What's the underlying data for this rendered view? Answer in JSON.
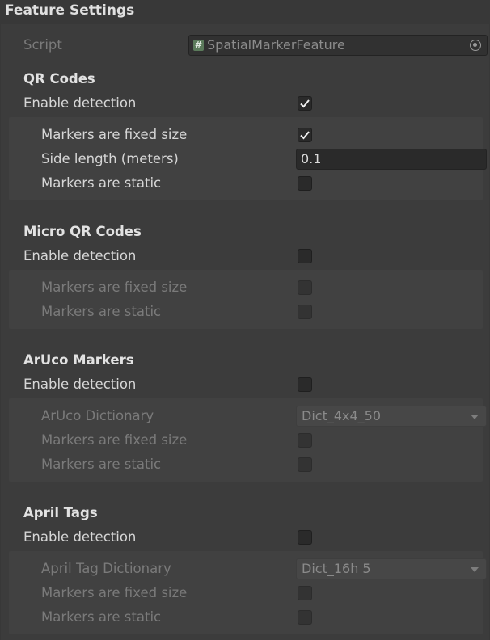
{
  "header": {
    "title": "Feature Settings"
  },
  "script": {
    "label": "Script",
    "value": "SpatialMarkerFeature",
    "icon": "script-hash-icon"
  },
  "qr": {
    "title": "QR Codes",
    "enable_label": "Enable detection",
    "enabled": true,
    "fixed_label": "Markers are fixed size",
    "fixed": true,
    "side_label": "Side length (meters)",
    "side_value": "0.1",
    "static_label": "Markers are static",
    "static": false
  },
  "microqr": {
    "title": "Micro QR Codes",
    "enable_label": "Enable detection",
    "enabled": false,
    "fixed_label": "Markers are fixed size",
    "static_label": "Markers are static"
  },
  "aruco": {
    "title": "ArUco Markers",
    "enable_label": "Enable detection",
    "enabled": false,
    "dict_label": "ArUco Dictionary",
    "dict_value": "Dict_4x4_50",
    "fixed_label": "Markers are fixed size",
    "static_label": "Markers are static"
  },
  "april": {
    "title": "April Tags",
    "enable_label": "Enable detection",
    "enabled": false,
    "dict_label": "April Tag Dictionary",
    "dict_value": "Dict_16h 5",
    "fixed_label": "Markers are fixed size",
    "static_label": "Markers are static"
  }
}
